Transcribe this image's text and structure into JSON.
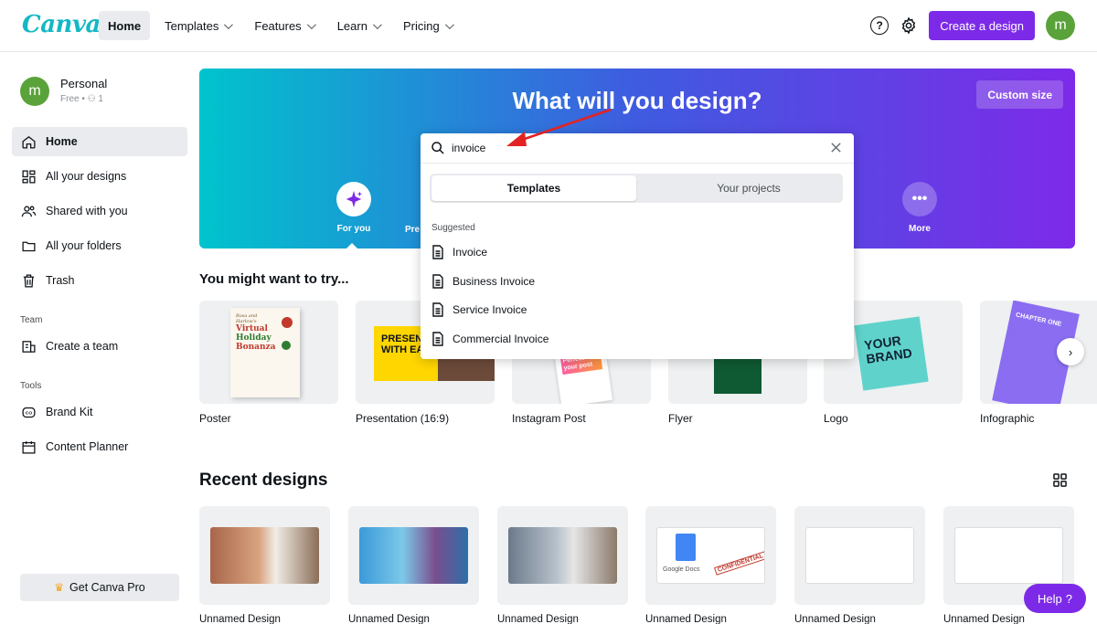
{
  "topbar": {
    "logo": "Canva",
    "nav": [
      {
        "label": "Home",
        "active": true
      },
      {
        "label": "Templates",
        "chevron": true
      },
      {
        "label": "Features",
        "chevron": true
      },
      {
        "label": "Learn",
        "chevron": true
      },
      {
        "label": "Pricing",
        "chevron": true
      }
    ],
    "help_icon": "?",
    "create_label": "Create a design",
    "avatar_letter": "m"
  },
  "sidebar": {
    "account_name": "Personal",
    "account_sub": "Free • ⚇ 1",
    "avatar_letter": "m",
    "items": [
      {
        "label": "Home",
        "icon": "home-icon"
      },
      {
        "label": "All your designs",
        "icon": "grid-icon"
      },
      {
        "label": "Shared with you",
        "icon": "people-icon"
      },
      {
        "label": "All your folders",
        "icon": "folder-icon"
      },
      {
        "label": "Trash",
        "icon": "trash-icon"
      }
    ],
    "team_heading": "Team",
    "team_item": "Create a team",
    "tools_heading": "Tools",
    "tools_items": [
      "Brand Kit",
      "Content Planner"
    ],
    "pro_label": "Get Canva Pro"
  },
  "hero": {
    "title": "What will you design?",
    "custom_size": "Custom size",
    "for_you": "For you",
    "partial": "Pre",
    "more": "More"
  },
  "try_section": {
    "title": "You might want to try...",
    "cards": [
      "Poster",
      "Presentation (16:9)",
      "Instagram Post",
      "Flyer",
      "Logo",
      "Infographic"
    ],
    "poster_text": [
      "Rosa and",
      "Harlow's",
      "Virtual",
      "Holiday",
      "Bonanza"
    ],
    "presentation_text": [
      "PRESENT",
      "WITH EAS"
    ],
    "instagram_text": [
      "Perfect",
      "your post"
    ],
    "logo_text": [
      "YOUR",
      "BRAND"
    ],
    "infographic_text": "CHAPTER ONE"
  },
  "recent": {
    "title": "Recent designs",
    "cards": [
      "Unnamed Design",
      "Unnamed Design",
      "Unnamed Design",
      "Unnamed Design",
      "Unnamed Design",
      "Unnamed Design"
    ],
    "docs_label": "Google Docs",
    "confidential": "CONFIDENTIAL"
  },
  "search": {
    "value": "invoice",
    "tabs": [
      "Templates",
      "Your projects"
    ],
    "suggested_heading": "Suggested",
    "suggestions": [
      "Invoice",
      "Business Invoice",
      "Service Invoice",
      "Commercial Invoice"
    ]
  },
  "help": {
    "label": "Help",
    "icon": "?"
  },
  "colors": {
    "accent": "#7d2ae8",
    "teal": "#00c4cc",
    "avatar": "#5aa33a",
    "arrow": "#e32323"
  }
}
